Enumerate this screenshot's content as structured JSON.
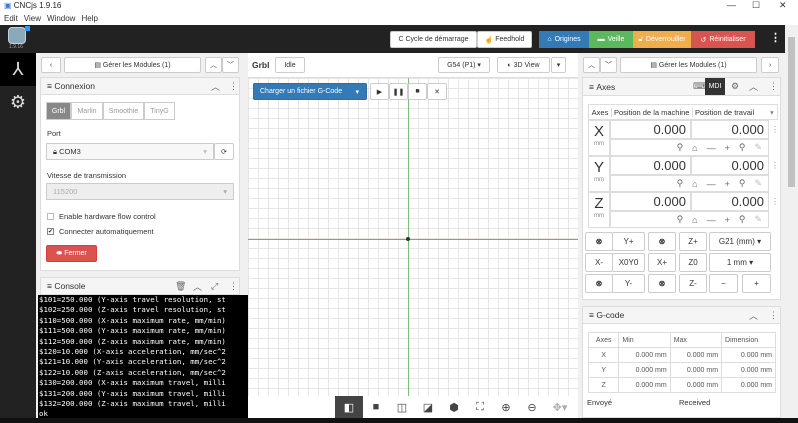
{
  "window": {
    "title": "CNCjs 1.9.16",
    "version": "1.9.16",
    "controls": [
      "—",
      "☐",
      "✕"
    ]
  },
  "menu": [
    "Edit",
    "View",
    "Window",
    "Help"
  ],
  "header": {
    "cycle_start": "Cycle de démarrage",
    "feedhold": "Feedhold",
    "homing": "Origines",
    "sleep": "Veille",
    "unlock": "Déverrouiller",
    "reset": "Réinitialiser",
    "colors": {
      "homing": "#337ab7",
      "sleep": "#5cb85c",
      "unlock": "#f0ad4e",
      "reset": "#d9534f"
    }
  },
  "left": {
    "manage_modules": "Gérer les Modules (1)",
    "connection": {
      "title": "Connexion",
      "tabs": [
        "Grbl",
        "Marlin",
        "Smoothie",
        "TinyG"
      ],
      "port_label": "Port",
      "port_value": "COM3",
      "baud_label": "Vitesse de transmission",
      "baud_value": "115200",
      "hw_flow": "Enable hardware flow control",
      "hw_flow_checked": false,
      "auto_connect": "Connecter automatiquement",
      "auto_connect_checked": true,
      "close_button": "Fermer"
    },
    "console": {
      "title": "Console",
      "lines": [
        "$101=250.000 (Y-axis travel resolution, st",
        "$102=250.000 (Z-axis travel resolution, st",
        "$110=500.000 (X-axis maximum rate, mm/min)",
        "$111=500.000 (Y-axis maximum rate, mm/min)",
        "$112=500.000 (Z-axis maximum rate, mm/min)",
        "$120=10.000 (X-axis acceleration, mm/sec^2",
        "$121=10.000 (Y-axis acceleration, mm/sec^2",
        "$122=10.000 (Z-axis acceleration, mm/sec^2",
        "$130=200.000 (X-axis maximum travel, milli",
        "$131=200.000 (Y-axis maximum travel, milli",
        "$132=200.000 (Z-axis maximum travel, milli",
        "ok"
      ]
    }
  },
  "center": {
    "controller": "Grbl",
    "state": "Idle",
    "wcs": "G54 (P1)",
    "view": "3D View",
    "load_gcode": "Charger un fichier G-Code"
  },
  "right": {
    "manage_modules": "Gérer les Modules (1)",
    "axes": {
      "title": "Axes",
      "mdi": "MDI",
      "col_axes": "Axes",
      "col_machine": "Position de la machine",
      "col_work": "Position de travail",
      "rows": [
        {
          "axis": "X",
          "unit": "mm",
          "machine": "0.000",
          "work": "0.000"
        },
        {
          "axis": "Y",
          "unit": "mm",
          "machine": "0.000",
          "work": "0.000"
        },
        {
          "axis": "Z",
          "unit": "mm",
          "machine": "0.000",
          "work": "0.000"
        }
      ],
      "jog": {
        "yplus": "Y+",
        "zplus": "Z+",
        "units": "G21 (mm)",
        "xminus": "X-",
        "x0y0": "X0Y0",
        "xplus": "X+",
        "z0": "Z0",
        "step": "1 mm",
        "yminus": "Y-",
        "zminus": "Z-",
        "minus": "−",
        "plus": "+"
      }
    },
    "gcode": {
      "title": "G-code",
      "headers": [
        "Axes",
        "Min",
        "Max",
        "Dimension"
      ],
      "rows": [
        [
          "X",
          "0.000 mm",
          "0.000 mm",
          "0.000 mm"
        ],
        [
          "Y",
          "0.000 mm",
          "0.000 mm",
          "0.000 mm"
        ],
        [
          "Z",
          "0.000 mm",
          "0.000 mm",
          "0.000 mm"
        ]
      ],
      "sent": "Envoyé",
      "received": "Received"
    }
  }
}
